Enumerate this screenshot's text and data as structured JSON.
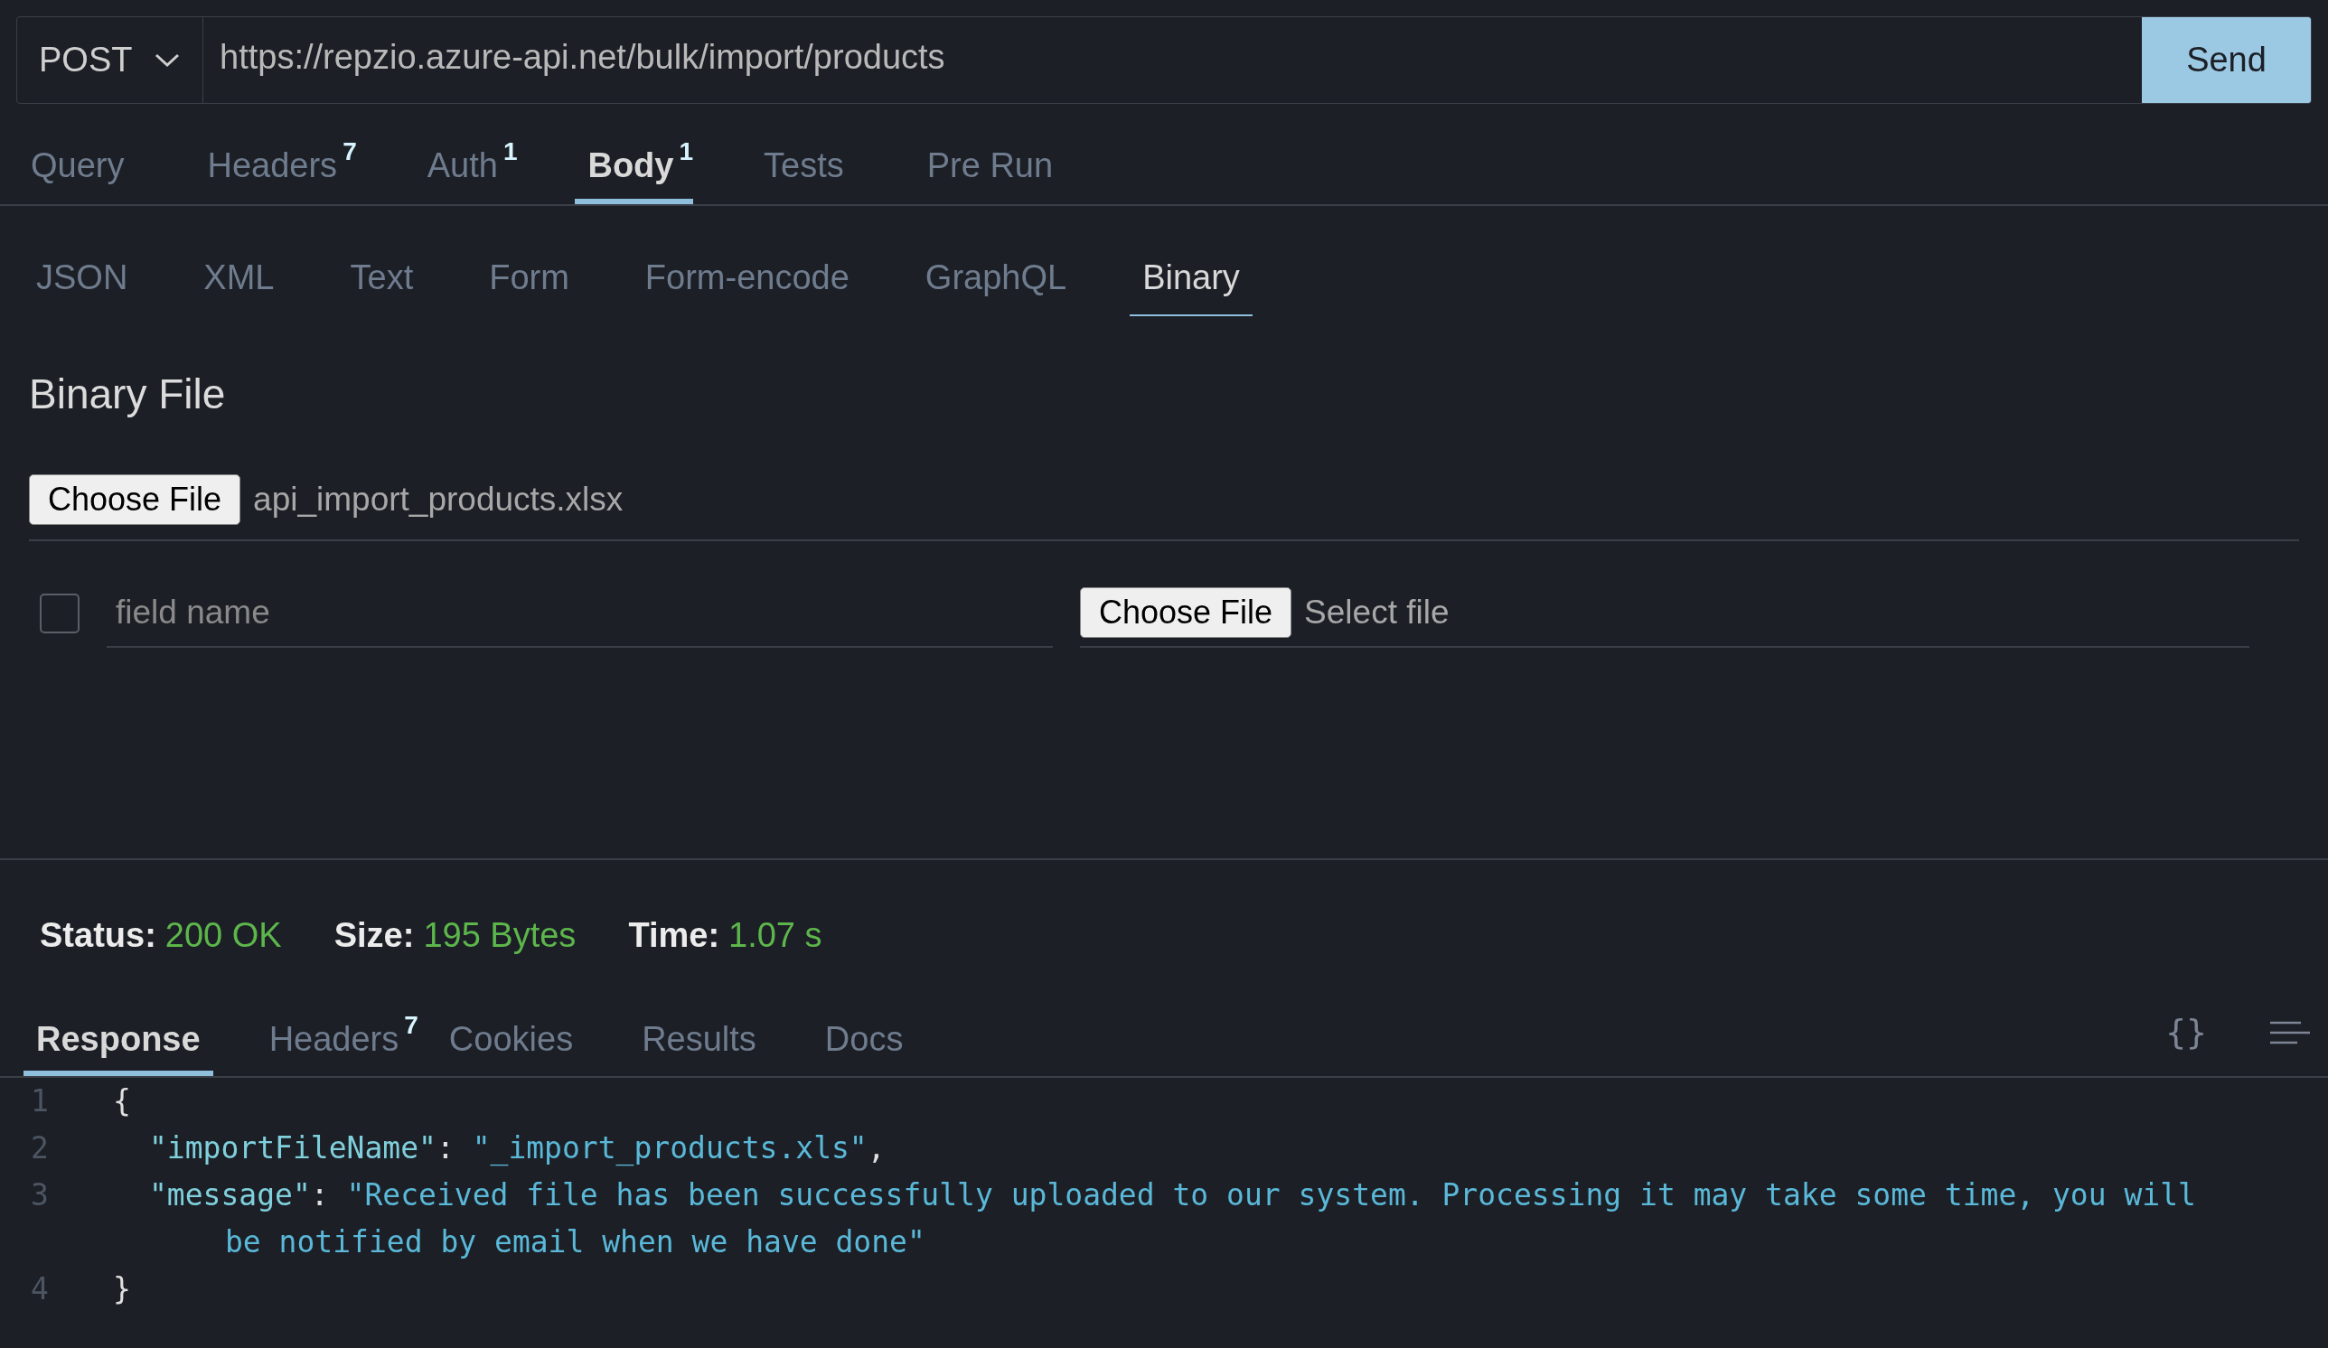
{
  "request": {
    "method": "POST",
    "url": "https://repzio.azure-api.net/bulk/import/products",
    "send_label": "Send"
  },
  "request_tabs": [
    {
      "label": "Query",
      "selected": false
    },
    {
      "label": "Headers",
      "badge": "7",
      "selected": false
    },
    {
      "label": "Auth",
      "badge": "1",
      "selected": false
    },
    {
      "label": "Body",
      "badge": "1",
      "selected": true
    },
    {
      "label": "Tests",
      "selected": false
    },
    {
      "label": "Pre Run",
      "selected": false
    }
  ],
  "body_tabs": [
    {
      "label": "JSON",
      "selected": false
    },
    {
      "label": "XML",
      "selected": false
    },
    {
      "label": "Text",
      "selected": false
    },
    {
      "label": "Form",
      "selected": false
    },
    {
      "label": "Form-encode",
      "selected": false
    },
    {
      "label": "GraphQL",
      "selected": false
    },
    {
      "label": "Binary",
      "selected": true
    }
  ],
  "binary": {
    "title": "Binary File",
    "choose_label": "Choose File",
    "file_name": "api_import_products.xlsx"
  },
  "form_row": {
    "checked": false,
    "field_placeholder": "field name",
    "choose_label": "Choose File",
    "file_text": "Select file"
  },
  "status": [
    {
      "label": "Status:",
      "value": "200 OK"
    },
    {
      "label": "Size:",
      "value": "195 Bytes"
    },
    {
      "label": "Time:",
      "value": "1.07 s"
    }
  ],
  "response_tabs": [
    {
      "label": "Response",
      "selected": true
    },
    {
      "label": "Headers",
      "badge": "7",
      "selected": false
    },
    {
      "label": "Cookies",
      "selected": false
    },
    {
      "label": "Results",
      "selected": false
    },
    {
      "label": "Docs",
      "selected": false
    }
  ],
  "format_button": "{}",
  "code_lines": [
    {
      "number": "1",
      "tokens": [
        {
          "kind": "punct",
          "text": "{"
        }
      ],
      "children": [
        {
          "number": "2",
          "tokens": [
            {
              "kind": "key",
              "text": "\"importFileName\""
            },
            {
              "kind": "punct",
              "text": ": "
            },
            {
              "kind": "string",
              "text": "\"_import_products.xls\""
            },
            {
              "kind": "punct",
              "text": ","
            }
          ]
        },
        {
          "number": "3",
          "tokens": [
            {
              "kind": "key",
              "text": "\"message\""
            },
            {
              "kind": "punct",
              "text": ": "
            },
            {
              "kind": "string",
              "text": "\"Received file has been successfully uploaded to our system. Processing it may take some time, you will be notified by email when we have done\""
            }
          ]
        }
      ]
    },
    {
      "number": "4",
      "tokens": [
        {
          "kind": "punct",
          "text": "}"
        }
      ]
    }
  ]
}
